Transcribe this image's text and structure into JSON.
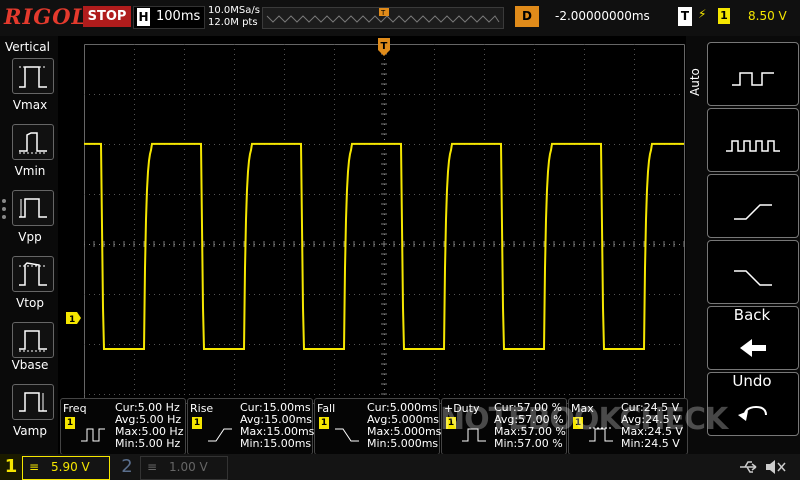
{
  "topbar": {
    "logo": "RIGOL",
    "run_state": "STOP",
    "horizontal_key": "H",
    "timebase": "100ms",
    "sample_rate": "10.0MSa/s",
    "memory_depth": "12.0M pts",
    "delay_key": "D",
    "delay_value": "-2.00000000ms",
    "trigger_key": "T",
    "trigger_edge_icon": "rising-edge-icon",
    "trigger_channel": "1",
    "trigger_level": "8.50 V"
  },
  "left_panel": {
    "title": "Vertical",
    "items": [
      {
        "label": "Vmax",
        "icon": "vmax-icon"
      },
      {
        "label": "Vmin",
        "icon": "vmin-icon"
      },
      {
        "label": "Vpp",
        "icon": "vpp-icon"
      },
      {
        "label": "Vtop",
        "icon": "vtop-icon"
      },
      {
        "label": "Vbase",
        "icon": "vbase-icon"
      },
      {
        "label": "Vamp",
        "icon": "vamp-icon"
      }
    ]
  },
  "right_panel": {
    "mode_label": "Auto",
    "buttons": [
      {
        "icon": "single-cycle-icon"
      },
      {
        "icon": "multi-cycle-icon"
      },
      {
        "icon": "rising-edge-icon"
      },
      {
        "icon": "falling-edge-icon"
      }
    ],
    "back_label": "Back",
    "undo_label": "Undo"
  },
  "markers": {
    "trigger_position": "T",
    "channel1_ground": "1"
  },
  "measurements": [
    {
      "name": "Freq",
      "channel": "1",
      "cur": "Cur:5.00 Hz",
      "avg": "Avg:5.00 Hz",
      "max": "Max:5.00 Hz",
      "min": "Min:5.00 Hz"
    },
    {
      "name": "Rise",
      "channel": "1",
      "cur": "Cur:15.00ms",
      "avg": "Avg:15.00ms",
      "max": "Max:15.00ms",
      "min": "Min:15.00ms"
    },
    {
      "name": "Fall",
      "channel": "1",
      "cur": "Cur:5.000ms",
      "avg": "Avg:5.000ms",
      "max": "Max:5.000ms",
      "min": "Min:5.000ms"
    },
    {
      "name": "+Duty",
      "channel": "1",
      "cur": "Cur:57.00 %",
      "avg": "Avg:57.00 %",
      "max": "Max:57.00 %",
      "min": "Min:57.00 %"
    },
    {
      "name": "Max",
      "channel": "1",
      "cur": "Cur:24.5 V",
      "avg": "Avg:24.5 V",
      "max": "Max:24.5 V",
      "min": "Min:24.5 V"
    }
  ],
  "bottombar": {
    "ch1_label": "1",
    "ch1_scale": "5.90 V",
    "ch2_label": "2",
    "ch2_scale": "1.00 V",
    "usb_icon": "usb-icon",
    "speaker_icon": "speaker-muted-icon"
  },
  "watermark": "NOTEBOOKCHECK",
  "colors": {
    "ch1": "#f5e600",
    "trigger": "#e08b1a",
    "stop": "#b01c1c",
    "logo": "#e43a2d"
  }
}
